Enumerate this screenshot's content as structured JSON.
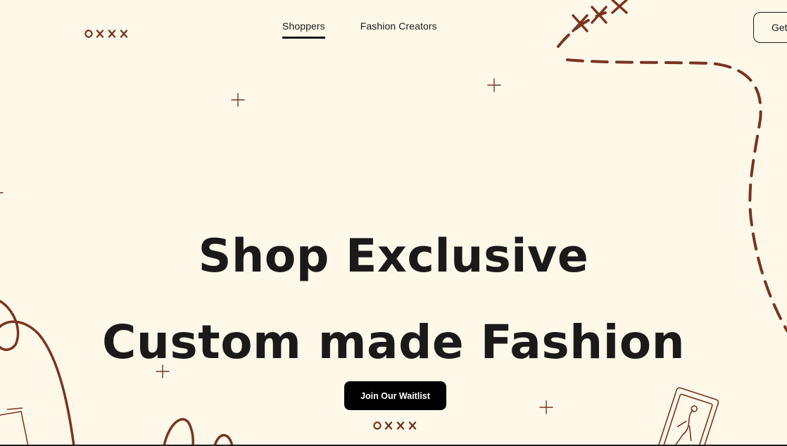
{
  "brand": {
    "logo_text": "oxxx",
    "accent_color": "#7a3420",
    "background_color": "#fef8e9"
  },
  "nav": {
    "items": [
      {
        "label": "Shoppers",
        "active": true
      },
      {
        "label": "Fashion Creators",
        "active": false
      }
    ]
  },
  "header": {
    "cta_label": "Get"
  },
  "hero": {
    "line1": "Shop Exclusive",
    "line2": "Custom made Fashion",
    "cta_label": "Join Our Waitlist"
  },
  "icons": {
    "sparkles": "plus-sparkle-icon",
    "logo": "oxxx-logo-icon"
  }
}
